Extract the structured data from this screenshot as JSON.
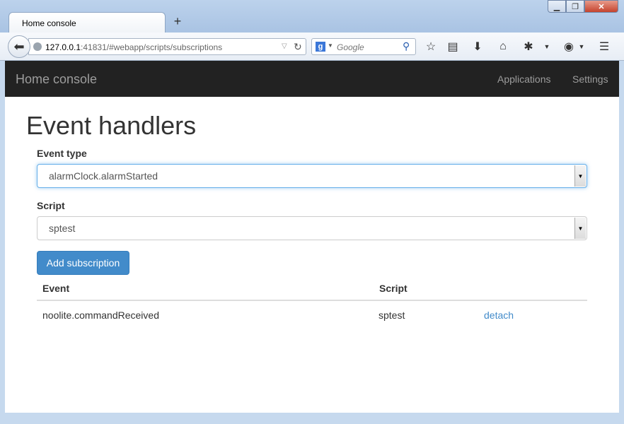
{
  "browser": {
    "tab_title": "Home console",
    "new_tab": "+",
    "url_host": "127.0.0.1",
    "url_rest": ":41831/#webapp/scripts/subscriptions",
    "search_placeholder": "Google",
    "search_engine_letter": "g"
  },
  "app": {
    "brand": "Home console",
    "nav": {
      "applications": "Applications",
      "settings": "Settings"
    }
  },
  "page": {
    "title": "Event handlers",
    "event_type": {
      "label": "Event type",
      "value": "alarmClock.alarmStarted"
    },
    "script": {
      "label": "Script",
      "value": "sptest"
    },
    "add_button": "Add subscription",
    "table": {
      "headers": [
        "Event",
        "Script"
      ],
      "rows": [
        {
          "event": "noolite.commandReceived",
          "script": "sptest",
          "action": "detach"
        }
      ]
    }
  },
  "colors": {
    "app_nav_bg": "#222222",
    "primary": "#428bca",
    "focus_border": "#66afe9"
  }
}
